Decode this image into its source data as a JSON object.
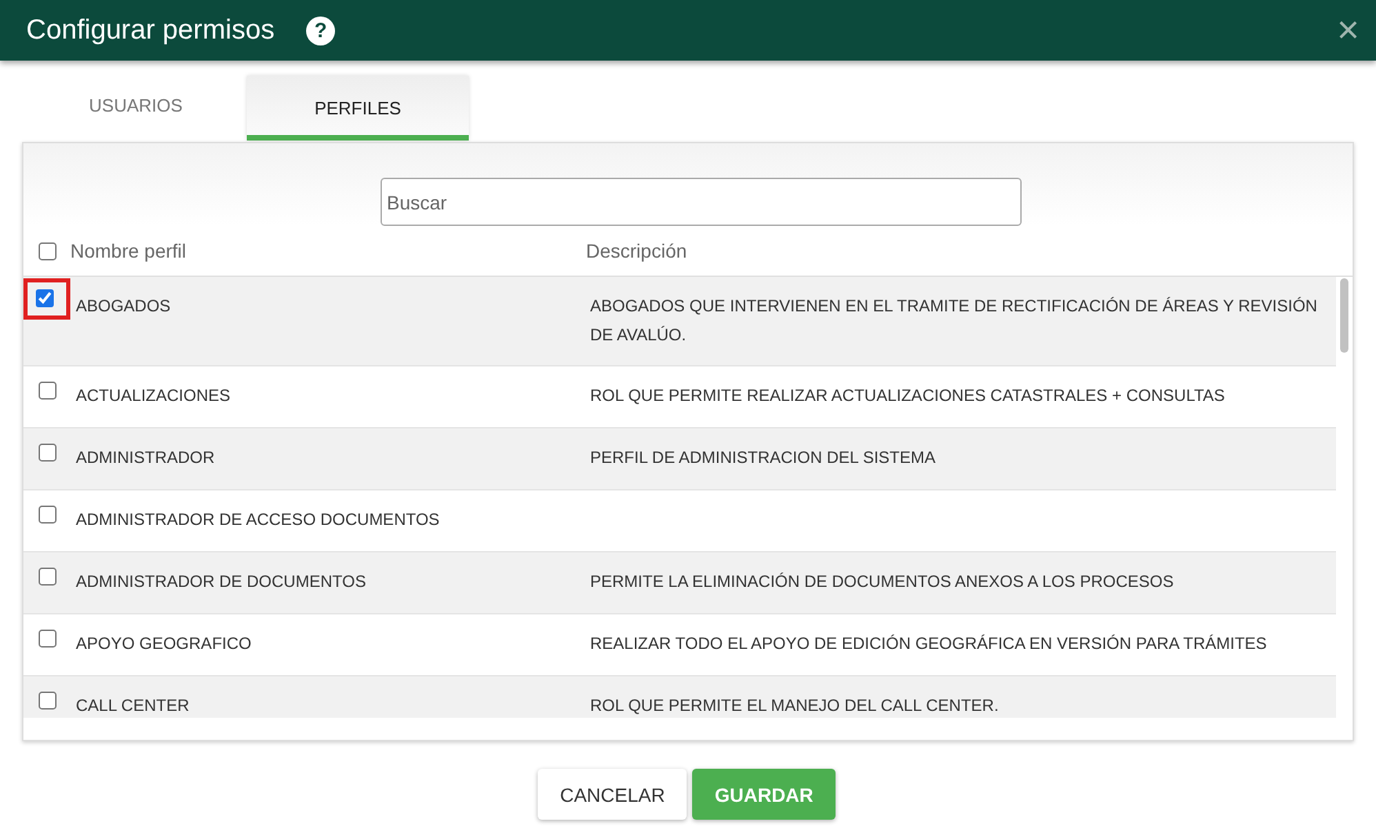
{
  "window": {
    "title": "Configurar permisos",
    "help": "?",
    "close": "×"
  },
  "tabs": [
    {
      "label": "USUARIOS",
      "selected": false
    },
    {
      "label": "PERFILES",
      "selected": true
    }
  ],
  "search": {
    "placeholder": "Buscar"
  },
  "table": {
    "select_all": false,
    "columns": [
      "Nombre perfil",
      "Descripción"
    ],
    "rows": [
      {
        "name": "ABOGADOS",
        "description": "ABOGADOS QUE INTERVIENEN EN EL TRAMITE DE RECTIFICACIÓN DE ÁREAS Y REVISIÓN DE AVALÚO.",
        "checked": true,
        "highlighted": true
      },
      {
        "name": "ACTUALIZACIONES",
        "description": "ROL QUE PERMITE REALIZAR ACTUALIZACIONES CATASTRALES + CONSULTAS",
        "checked": false,
        "highlighted": false
      },
      {
        "name": "ADMINISTRADOR",
        "description": "PERFIL DE ADMINISTRACION DEL SISTEMA",
        "checked": false,
        "highlighted": false
      },
      {
        "name": "ADMINISTRADOR DE ACCESO DOCUMENTOS",
        "checked": false,
        "highlighted": false
      },
      {
        "name": "ADMINISTRADOR DE DOCUMENTOS",
        "description": "PERMITE LA ELIMINACIÓN DE DOCUMENTOS ANEXOS A LOS PROCESOS",
        "checked": false,
        "highlighted": false
      },
      {
        "name": "APOYO GEOGRAFICO",
        "description": "REALIZAR TODO EL APOYO DE EDICIÓN GEOGRÁFICA EN VERSIÓN PARA TRÁMITES",
        "checked": false,
        "highlighted": false
      },
      {
        "name": "CALL CENTER",
        "description": "ROL QUE PERMITE EL MANEJO DEL CALL CENTER.",
        "checked": false,
        "highlighted": false
      }
    ]
  },
  "buttons": [
    {
      "label": "CANCELAR",
      "kind": "secondary"
    },
    {
      "label": "GUARDAR",
      "kind": "primary"
    }
  ]
}
